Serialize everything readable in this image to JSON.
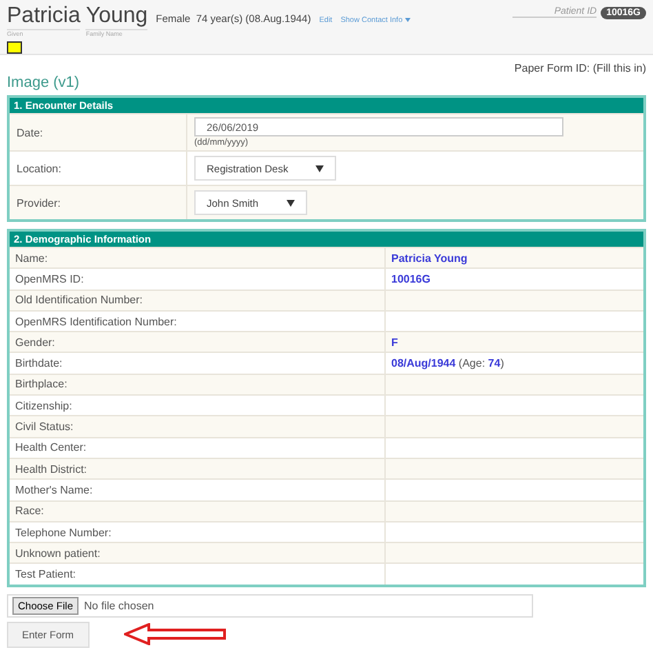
{
  "patient": {
    "given_name": "Patricia",
    "family_name": "Young",
    "given_label": "Given",
    "family_label": "Family Name",
    "gender": "Female",
    "age": "74 year(s) (08.Aug.1944)",
    "edit_link": "Edit",
    "contact_link": "Show Contact Info",
    "id_label": "Patient ID",
    "id": "10016G"
  },
  "paper_form_id": "Paper Form ID: (Fill this in)",
  "form_title": "Image (v1)",
  "encounter": {
    "title": "1. Encounter Details",
    "rows": [
      {
        "kind": "date",
        "label": "Date:",
        "value": "26/06/2019",
        "hint": "(dd/mm/yyyy)"
      },
      {
        "kind": "select",
        "label": "Location:",
        "value": "Registration Desk"
      },
      {
        "kind": "select",
        "label": "Provider:",
        "value": "John Smith"
      }
    ]
  },
  "demographics": {
    "title": "2. Demographic Information",
    "rows": [
      {
        "label": "Name:",
        "kind": "value",
        "value": "Patricia Young"
      },
      {
        "label": "OpenMRS ID:",
        "kind": "value",
        "value": "10016G"
      },
      {
        "label": "Old Identification Number:"
      },
      {
        "label": "OpenMRS Identification Number:"
      },
      {
        "label": "Gender:",
        "kind": "value",
        "value": "F"
      },
      {
        "label": "Birthdate:",
        "kind": "mixed",
        "value": "**08/Aug/1944** (Age: **74**)"
      },
      {
        "label": "Birthplace:"
      },
      {
        "label": "Citizenship:"
      },
      {
        "label": "Civil Status:"
      },
      {
        "label": "Health Center:"
      },
      {
        "label": "Health District:"
      },
      {
        "label": "Mother's Name:"
      },
      {
        "label": "Race:"
      },
      {
        "label": "Telephone Number:"
      },
      {
        "label": "Unknown patient:"
      },
      {
        "label": "Test Patient:"
      }
    ]
  },
  "file_input": {
    "button": "Choose File",
    "status": "No file chosen"
  },
  "submit": "Enter Form"
}
